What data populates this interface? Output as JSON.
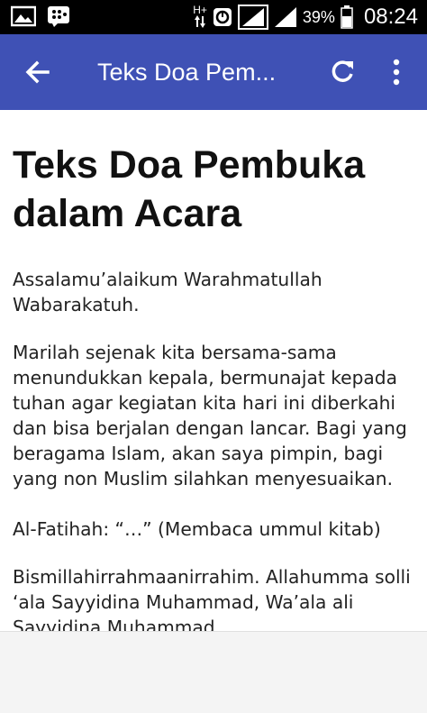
{
  "status_bar": {
    "network_label": "H+",
    "battery_percent": "39%",
    "clock": "08:24",
    "icons": [
      "image-icon",
      "bbm-icon",
      "data-arrows-icon",
      "circle-icon",
      "signal-icon",
      "signal-icon-2",
      "battery-icon"
    ]
  },
  "app_bar": {
    "title": "Teks Doa Pem...",
    "icons": [
      "arrow-back-icon",
      "refresh-icon",
      "more-vert-icon"
    ],
    "background": "#3f51b5"
  },
  "article": {
    "heading": "Teks Doa Pembuka dalam Acara",
    "paragraphs": [
      "Assalamu’alaikum Warahmatullah Wabarakatuh.",
      "Marilah sejenak kita bersama-sama menundukkan kepala, bermunajat kepada tuhan agar kegiatan kita hari ini diberkahi dan bisa berjalan dengan lancar. Bagi yang beragama Islam, akan saya pimpin, bagi yang non Muslim silahkan menyesuaikan.",
      "Al-Fatihah: “…” (Membaca ummul kitab)",
      "Bismillahirrahmaanirrahim. Allahumma solli ‘ala Sayyidina Muhammad, Wa’ala ali Sayyidina Muhammad."
    ]
  }
}
